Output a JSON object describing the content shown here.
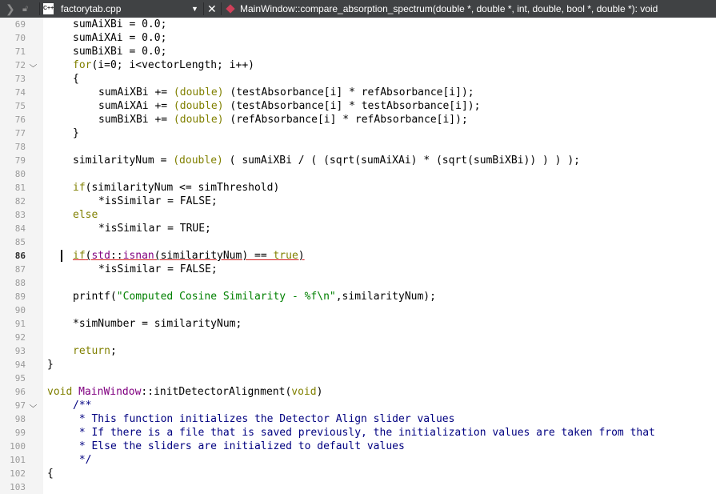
{
  "tab": {
    "file_icon_label": "C++",
    "filename": "factorytab.cpp"
  },
  "symbol": {
    "signature": "MainWindow::compare_absorption_spectrum(double *, double *, int, double, bool *, double *): void"
  },
  "current_line": "86",
  "lines": [
    {
      "n": "69",
      "indent": 2,
      "fold": false,
      "tokens": [
        {
          "t": "sumAiXBi = 0.0;"
        }
      ]
    },
    {
      "n": "70",
      "indent": 2,
      "fold": false,
      "tokens": [
        {
          "t": "sumAiXAi = 0.0;"
        }
      ]
    },
    {
      "n": "71",
      "indent": 2,
      "fold": false,
      "tokens": [
        {
          "t": "sumBiXBi = 0.0;"
        }
      ]
    },
    {
      "n": "72",
      "indent": 2,
      "fold": true,
      "tokens": [
        {
          "t": "for",
          "c": "kw"
        },
        {
          "t": "(i=0; i<vectorLength; i++)"
        }
      ]
    },
    {
      "n": "73",
      "indent": 2,
      "fold": false,
      "tokens": [
        {
          "t": "{"
        }
      ]
    },
    {
      "n": "74",
      "indent": 4,
      "fold": false,
      "tokens": [
        {
          "t": "sumAiXBi += "
        },
        {
          "t": "(double)",
          "c": "ty"
        },
        {
          "t": " (testAbsorbance[i] * refAbsorbance[i]);"
        }
      ]
    },
    {
      "n": "75",
      "indent": 4,
      "fold": false,
      "tokens": [
        {
          "t": "sumAiXAi += "
        },
        {
          "t": "(double)",
          "c": "ty"
        },
        {
          "t": " (testAbsorbance[i] * testAbsorbance[i]);"
        }
      ]
    },
    {
      "n": "76",
      "indent": 4,
      "fold": false,
      "tokens": [
        {
          "t": "sumBiXBi += "
        },
        {
          "t": "(double)",
          "c": "ty"
        },
        {
          "t": " (refAbsorbance[i] * refAbsorbance[i]);"
        }
      ]
    },
    {
      "n": "77",
      "indent": 2,
      "fold": false,
      "tokens": [
        {
          "t": "}"
        }
      ]
    },
    {
      "n": "78",
      "indent": 0,
      "fold": false,
      "tokens": []
    },
    {
      "n": "79",
      "indent": 2,
      "fold": false,
      "tokens": [
        {
          "t": "similarityNum = "
        },
        {
          "t": "(double)",
          "c": "ty"
        },
        {
          "t": " ( sumAiXBi / ( (sqrt(sumAiXAi) * (sqrt(sumBiXBi)) ) ) );"
        }
      ]
    },
    {
      "n": "80",
      "indent": 0,
      "fold": false,
      "tokens": []
    },
    {
      "n": "81",
      "indent": 2,
      "fold": false,
      "tokens": [
        {
          "t": "if",
          "c": "kw"
        },
        {
          "t": "(similarityNum <= simThreshold)"
        }
      ]
    },
    {
      "n": "82",
      "indent": 4,
      "fold": false,
      "tokens": [
        {
          "t": "*isSimilar = FALSE;"
        }
      ]
    },
    {
      "n": "83",
      "indent": 2,
      "fold": false,
      "tokens": [
        {
          "t": "else",
          "c": "kw"
        }
      ]
    },
    {
      "n": "84",
      "indent": 4,
      "fold": false,
      "tokens": [
        {
          "t": "*isSimilar = TRUE;"
        }
      ]
    },
    {
      "n": "85",
      "indent": 0,
      "fold": false,
      "tokens": []
    },
    {
      "n": "86",
      "indent": 2,
      "fold": false,
      "tokens": [
        {
          "t": "if",
          "c": "kw err"
        },
        {
          "t": "(",
          "c": "err"
        },
        {
          "t": "std",
          "c": "cls err"
        },
        {
          "t": "::",
          "c": "err"
        },
        {
          "t": "isnan",
          "c": "cls err"
        },
        {
          "t": "(similarityNum) == ",
          "c": "err"
        },
        {
          "t": "true",
          "c": "kw err"
        },
        {
          "t": ")",
          "c": "err"
        }
      ]
    },
    {
      "n": "87",
      "indent": 4,
      "fold": false,
      "tokens": [
        {
          "t": "*isSimilar = FALSE;"
        }
      ]
    },
    {
      "n": "88",
      "indent": 0,
      "fold": false,
      "tokens": []
    },
    {
      "n": "89",
      "indent": 2,
      "fold": false,
      "tokens": [
        {
          "t": "printf("
        },
        {
          "t": "\"Computed Cosine Similarity - %f\\n\"",
          "c": "str"
        },
        {
          "t": ",similarityNum);"
        }
      ]
    },
    {
      "n": "90",
      "indent": 0,
      "fold": false,
      "tokens": []
    },
    {
      "n": "91",
      "indent": 2,
      "fold": false,
      "tokens": [
        {
          "t": "*simNumber = similarityNum;"
        }
      ]
    },
    {
      "n": "92",
      "indent": 0,
      "fold": false,
      "tokens": []
    },
    {
      "n": "93",
      "indent": 2,
      "fold": false,
      "tokens": [
        {
          "t": "return",
          "c": "kw"
        },
        {
          "t": ";"
        }
      ]
    },
    {
      "n": "94",
      "indent": 0,
      "fold": false,
      "tokens": [
        {
          "t": "}"
        }
      ]
    },
    {
      "n": "95",
      "indent": 0,
      "fold": false,
      "tokens": []
    },
    {
      "n": "96",
      "indent": 0,
      "fold": false,
      "tokens": [
        {
          "t": "void",
          "c": "kw"
        },
        {
          "t": " "
        },
        {
          "t": "MainWindow",
          "c": "cls"
        },
        {
          "t": "::"
        },
        {
          "t": "initDetectorAlignment",
          "c": ""
        },
        {
          "t": "("
        },
        {
          "t": "void",
          "c": "kw"
        },
        {
          "t": ")"
        }
      ]
    },
    {
      "n": "97",
      "indent": 2,
      "fold": true,
      "tokens": [
        {
          "t": "/**",
          "c": "cmt"
        }
      ]
    },
    {
      "n": "98",
      "indent": 2,
      "fold": false,
      "tokens": [
        {
          "t": " * This function initializes the Detector Align slider values",
          "c": "cmt"
        }
      ]
    },
    {
      "n": "99",
      "indent": 2,
      "fold": false,
      "tokens": [
        {
          "t": " * If there is a file that is saved previously, the initialization values are taken from that",
          "c": "cmt"
        }
      ]
    },
    {
      "n": "100",
      "indent": 2,
      "fold": false,
      "tokens": [
        {
          "t": " * Else the sliders are initialized to default values",
          "c": "cmt"
        }
      ]
    },
    {
      "n": "101",
      "indent": 2,
      "fold": false,
      "tokens": [
        {
          "t": " */",
          "c": "cmt"
        }
      ]
    },
    {
      "n": "102",
      "indent": 0,
      "fold": false,
      "tokens": [
        {
          "t": "{"
        }
      ]
    },
    {
      "n": "103",
      "indent": 0,
      "fold": false,
      "tokens": []
    }
  ]
}
